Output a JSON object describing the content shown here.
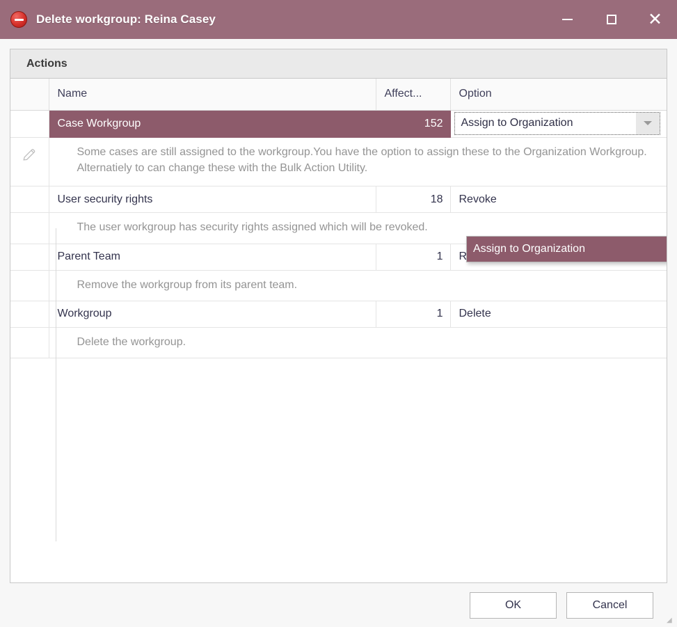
{
  "window": {
    "title": "Delete workgroup: Reina Casey",
    "title_icon": "no-entry-delete-icon",
    "minimize_label": "—",
    "maximize_label": "□",
    "close_label": "✕",
    "accent_titlebar": "#9a6c7b",
    "accent_selection": "#8d5b6b"
  },
  "group": {
    "header": "Actions"
  },
  "columns": {
    "gutter": "",
    "name": "Name",
    "affected": "Affect...",
    "option": "Option"
  },
  "rows": [
    {
      "name": "Case Workgroup",
      "affected": "152",
      "option": "Assign to Organization",
      "selected": true,
      "editor": "combobox",
      "gutter_icon": "pencil-edit-icon",
      "description": "Some cases are still assigned to the workgroup.You have the option to assign these to the Organization Workgroup. Alternatiely to can change these with the Bulk Action Utility."
    },
    {
      "name": "User security rights",
      "affected": "18",
      "option": "Revoke",
      "selected": false,
      "editor": "text",
      "description": "The user workgroup has security rights assigned which will be revoked."
    },
    {
      "name": "Parent Team",
      "affected": "1",
      "option": "Remove",
      "selected": false,
      "editor": "text",
      "description": "Remove the workgroup from its parent team."
    },
    {
      "name": "Workgroup",
      "affected": "1",
      "option": "Delete",
      "selected": false,
      "editor": "text",
      "description": "Delete the workgroup."
    }
  ],
  "dropdown": {
    "open": true,
    "options": [
      "Assign to Organization"
    ],
    "highlighted": "Assign to Organization"
  },
  "footer": {
    "ok": "OK",
    "cancel": "Cancel"
  }
}
